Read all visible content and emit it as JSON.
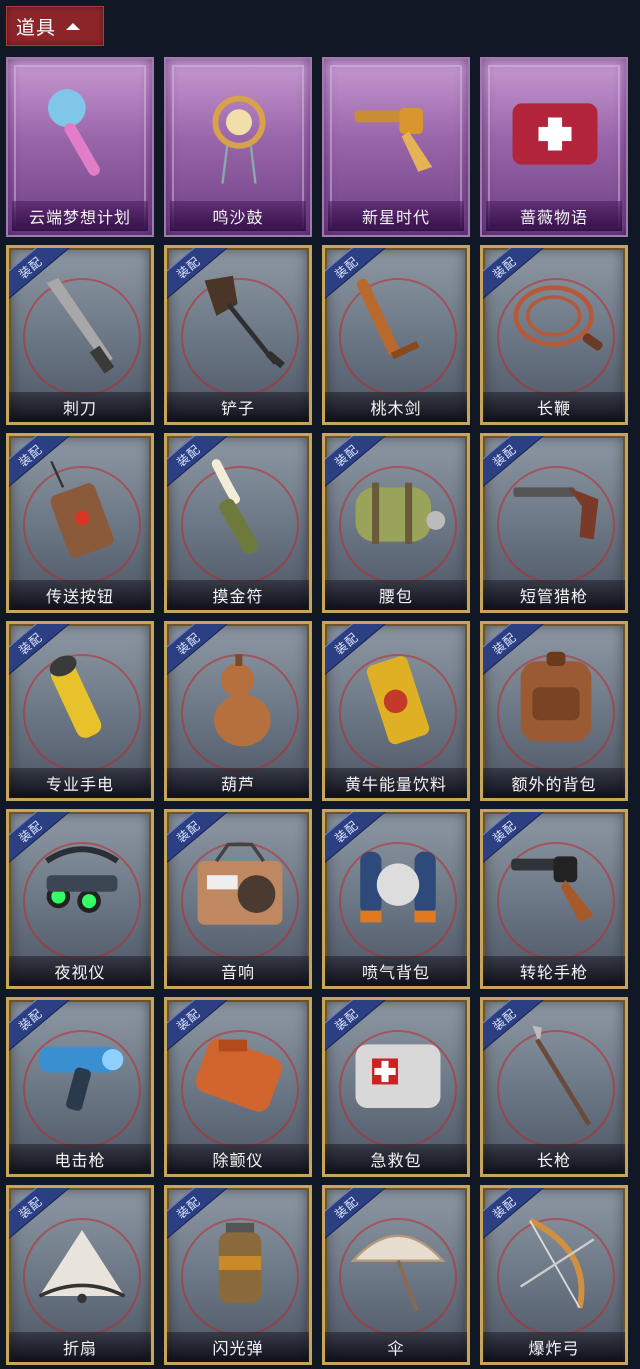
{
  "section": {
    "title": "道具",
    "toggle_icon": "chevron-up-icon"
  },
  "equip_tag": "装配",
  "items": [
    {
      "name": "云端梦想计划",
      "rarity": "special",
      "icon": "scepter-icon",
      "color": "#7fc6e8"
    },
    {
      "name": "鸣沙鼓",
      "rarity": "special",
      "icon": "drum-icon",
      "color": "#d8a24a"
    },
    {
      "name": "新星时代",
      "rarity": "special",
      "icon": "revolver-icon",
      "color": "#d9962e"
    },
    {
      "name": "蔷薇物语",
      "rarity": "special",
      "icon": "medkit-icon",
      "color": "#b2243b"
    },
    {
      "name": "刺刀",
      "rarity": "common",
      "icon": "knife-icon",
      "color": "#a8a8a8"
    },
    {
      "name": "铲子",
      "rarity": "common",
      "icon": "shovel-icon",
      "color": "#4a3526"
    },
    {
      "name": "桃木剑",
      "rarity": "common",
      "icon": "wooden-sword-icon",
      "color": "#b86a2e"
    },
    {
      "name": "长鞭",
      "rarity": "common",
      "icon": "whip-icon",
      "color": "#b45a3a"
    },
    {
      "name": "传送按钮",
      "rarity": "common",
      "icon": "remote-icon",
      "color": "#8a5a3a"
    },
    {
      "name": "摸金符",
      "rarity": "common",
      "icon": "amulet-icon",
      "color": "#6e7a3c"
    },
    {
      "name": "腰包",
      "rarity": "common",
      "icon": "bag-icon",
      "color": "#9aa35a"
    },
    {
      "name": "短管猎枪",
      "rarity": "common",
      "icon": "shotgun-icon",
      "color": "#7a3a2a"
    },
    {
      "name": "专业手电",
      "rarity": "common",
      "icon": "flashlight-icon",
      "color": "#e7c22a"
    },
    {
      "name": "葫芦",
      "rarity": "common",
      "icon": "gourd-icon",
      "color": "#b5703e"
    },
    {
      "name": "黄牛能量饮料",
      "rarity": "common",
      "icon": "can-icon",
      "color": "#e0b024"
    },
    {
      "name": "额外的背包",
      "rarity": "common",
      "icon": "backpack-icon",
      "color": "#9a5a34"
    },
    {
      "name": "夜视仪",
      "rarity": "common",
      "icon": "goggles-icon",
      "color": "#3b4652"
    },
    {
      "name": "音响",
      "rarity": "common",
      "icon": "radio-icon",
      "color": "#c08860"
    },
    {
      "name": "喷气背包",
      "rarity": "common",
      "icon": "jetpack-icon",
      "color": "#2e4a7a"
    },
    {
      "name": "转轮手枪",
      "rarity": "common",
      "icon": "pistol-icon",
      "color": "#303438"
    },
    {
      "name": "电击枪",
      "rarity": "common",
      "icon": "taser-icon",
      "color": "#3a8fd0"
    },
    {
      "name": "除颤仪",
      "rarity": "common",
      "icon": "defibrillator-icon",
      "color": "#d0662e"
    },
    {
      "name": "急救包",
      "rarity": "common",
      "icon": "first-aid-icon",
      "color": "#d8d8d8"
    },
    {
      "name": "长枪",
      "rarity": "common",
      "icon": "spear-icon",
      "color": "#6a4a3a"
    },
    {
      "name": "折扇",
      "rarity": "common",
      "icon": "fan-icon",
      "color": "#e8e4dc"
    },
    {
      "name": "闪光弹",
      "rarity": "common",
      "icon": "grenade-icon",
      "color": "#8a6a3a"
    },
    {
      "name": "伞",
      "rarity": "common",
      "icon": "umbrella-icon",
      "color": "#e6dccf"
    },
    {
      "name": "爆炸弓",
      "rarity": "common",
      "icon": "bow-icon",
      "color": "#d09040"
    }
  ]
}
